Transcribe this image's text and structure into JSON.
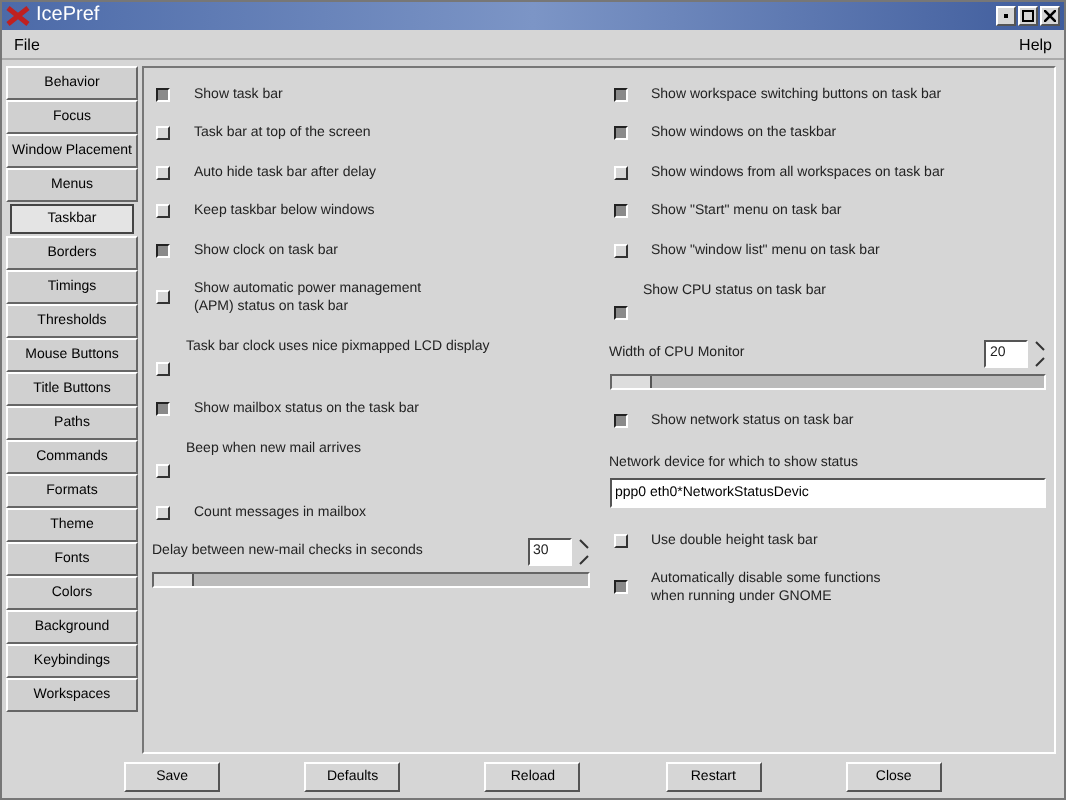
{
  "window": {
    "title": "IcePref"
  },
  "menu": [
    "File",
    "Help"
  ],
  "sidebar": {
    "items": [
      {
        "label": "Behavior",
        "selected": false
      },
      {
        "label": "Focus",
        "selected": false
      },
      {
        "label": "Window Placement",
        "selected": false
      },
      {
        "label": "Menus",
        "selected": false
      },
      {
        "label": "Taskbar",
        "selected": true
      },
      {
        "label": "Borders",
        "selected": false
      },
      {
        "label": "Timings",
        "selected": false
      },
      {
        "label": "Thresholds",
        "selected": false
      },
      {
        "label": "Mouse Buttons",
        "selected": false
      },
      {
        "label": "Title Buttons",
        "selected": false
      },
      {
        "label": "Paths",
        "selected": false
      },
      {
        "label": "Commands",
        "selected": false
      },
      {
        "label": "Formats",
        "selected": false
      },
      {
        "label": "Theme",
        "selected": false
      },
      {
        "label": "Fonts",
        "selected": false
      },
      {
        "label": "Colors",
        "selected": false
      },
      {
        "label": "Background",
        "selected": false
      },
      {
        "label": "Keybindings",
        "selected": false
      },
      {
        "label": "Workspaces",
        "selected": false
      }
    ]
  },
  "columns": [
    {
      "items": [
        {
          "kind": "check",
          "label": "Show task bar",
          "checked": true
        },
        {
          "kind": "check",
          "label": "Task bar at top of the screen",
          "checked": false
        },
        {
          "kind": "check",
          "label": "Auto hide task bar after delay",
          "checked": false
        },
        {
          "kind": "check",
          "label": "Keep taskbar below windows",
          "checked": false
        },
        {
          "kind": "check",
          "label": "Show clock on task bar",
          "checked": true
        },
        {
          "kind": "check2",
          "label": "Show automatic power management",
          "label2": "(APM) status on task bar",
          "checked": false
        },
        {
          "kind": "checkbelow",
          "label": "Task bar clock uses nice pixmapped LCD display",
          "checked": false
        },
        {
          "kind": "check",
          "label": "Show mailbox status on the task bar",
          "checked": true
        },
        {
          "kind": "checkbelow",
          "label": "Beep when new mail arrives",
          "checked": false
        },
        {
          "kind": "check",
          "label": "Count messages in mailbox",
          "checked": false
        },
        {
          "kind": "spin",
          "label": "Delay between new-mail checks in seconds",
          "value": "30",
          "level": 0
        }
      ]
    },
    {
      "items": [
        {
          "kind": "check",
          "label": "Show workspace switching buttons on task bar",
          "checked": true
        },
        {
          "kind": "check",
          "label": "Show windows on the taskbar",
          "checked": true
        },
        {
          "kind": "check",
          "label": "Show windows from all workspaces on task bar",
          "checked": false
        },
        {
          "kind": "check",
          "label": "Show \"Start\" menu on task bar",
          "checked": true
        },
        {
          "kind": "check",
          "label": "Show \"window list\" menu on task bar",
          "checked": false
        },
        {
          "kind": "checkbelow",
          "label": "Show CPU status on task bar",
          "checked": true
        },
        {
          "kind": "spin",
          "label": "Width of CPU Monitor",
          "value": "20",
          "level": 0
        },
        {
          "kind": "check",
          "label": "Show network status on task bar",
          "checked": true
        },
        {
          "kind": "input",
          "label": "Network device for which to show status",
          "value": "ppp0 eth0*NetworkStatusDevic"
        },
        {
          "kind": "check",
          "label": "Use double height task bar",
          "checked": false
        },
        {
          "kind": "check2",
          "label": "Automatically disable some functions",
          "label2": "when running under GNOME",
          "checked": true
        }
      ]
    }
  ],
  "buttons": [
    "Save",
    "Defaults",
    "Reload",
    "Restart",
    "Close"
  ]
}
